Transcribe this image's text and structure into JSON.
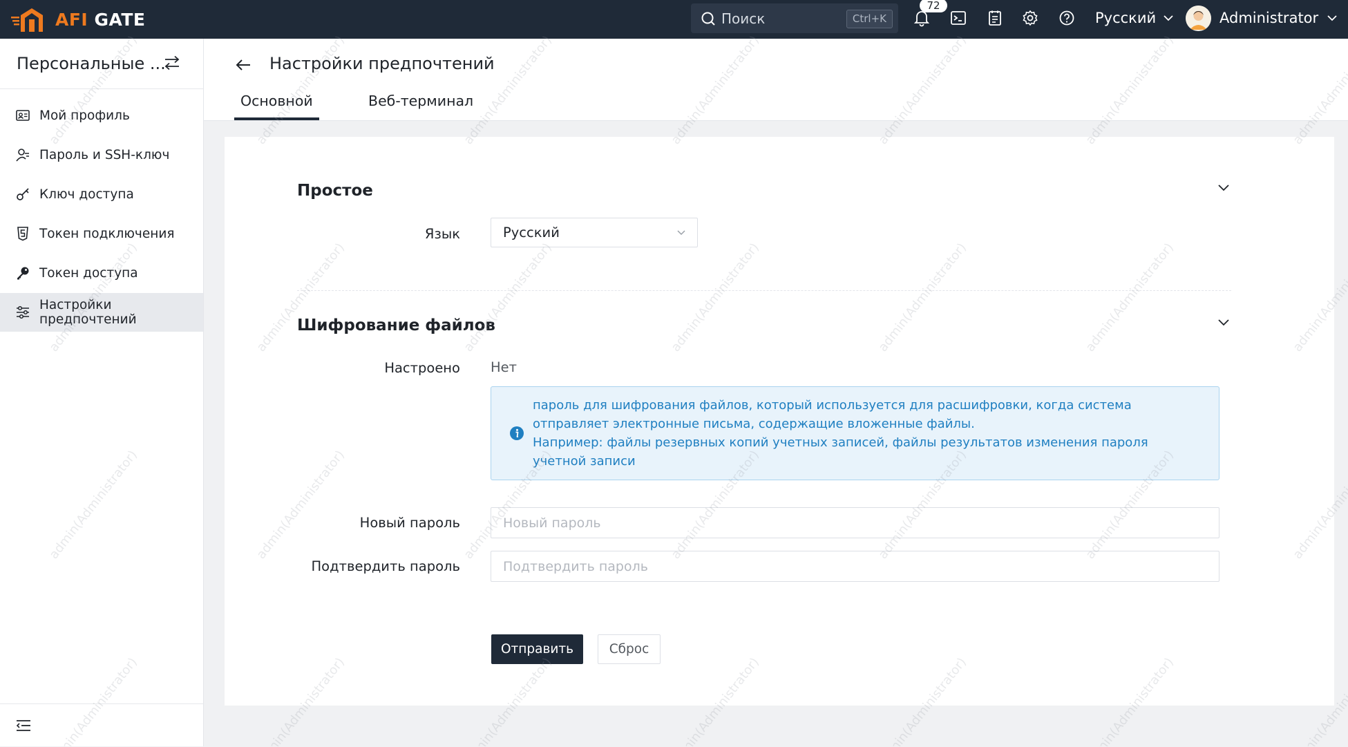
{
  "app": {
    "logo_text": "AFI GATE",
    "search_placeholder": "Поиск",
    "search_shortcut": "Ctrl+K",
    "notification_count": "72",
    "language": "Русский",
    "user_name": "Administrator"
  },
  "sidebar": {
    "title": "Персональные ...",
    "items": [
      {
        "label": "Мой профиль",
        "icon": "id-card-icon"
      },
      {
        "label": "Пароль и SSH-ключ",
        "icon": "user-key-icon"
      },
      {
        "label": "Ключ доступа",
        "icon": "key-icon"
      },
      {
        "label": "Токен подключения",
        "icon": "token-shield-icon"
      },
      {
        "label": "Токен доступа",
        "icon": "access-key-icon"
      },
      {
        "label": "Настройки предпочтений",
        "icon": "sliders-icon",
        "active": true
      }
    ]
  },
  "page": {
    "title": "Настройки предпочтений",
    "tabs": [
      {
        "label": "Основной",
        "active": true
      },
      {
        "label": "Веб-терминал",
        "active": false
      }
    ]
  },
  "form": {
    "section_basic": "Простое",
    "language_label": "Язык",
    "language_value": "Русский",
    "section_encryption": "Шифрование файлов",
    "configured_label": "Настроено",
    "configured_value": "Нет",
    "info_line1": "пароль для шифрования файлов, который используется для расшифровки, когда система отправляет электронные письма, содержащие вложенные файлы.",
    "info_line2": "Например: файлы резервных копий учетных записей, файлы результатов изменения пароля учетной записи",
    "new_password_label": "Новый пароль",
    "new_password_placeholder": "Новый пароль",
    "confirm_password_label": "Подтвердить пароль",
    "confirm_password_placeholder": "Подтвердить пароль",
    "submit_label": "Отправить",
    "reset_label": "Сброс"
  },
  "watermark": "admin(Administrator)",
  "colors": {
    "topbar": "#1f2a38",
    "brand_orange": "#ee7a1f",
    "info_text": "#1f7fc1",
    "info_bg": "#e8f3fb"
  }
}
